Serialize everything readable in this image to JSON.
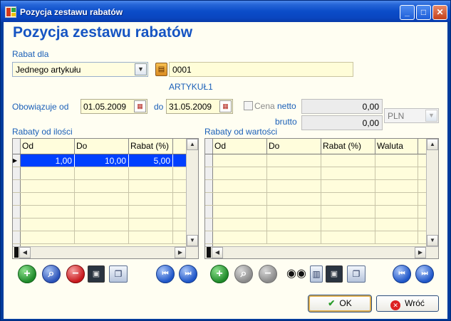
{
  "window": {
    "title": "Pozycja zestawu rabatów",
    "controls": {
      "minimize": "_",
      "maximize": "□",
      "close": "✕"
    }
  },
  "heading": "Pozycja zestawu rabatów",
  "rabat": {
    "label": "Rabat dla",
    "type_value": "Jednego artykułu",
    "code_value": "0001",
    "article_name": "ARTYKUŁ1"
  },
  "validity": {
    "label_from": "Obowiązuje od",
    "date_from": "01.05.2009",
    "label_to": "do",
    "date_to": "31.05.2009"
  },
  "price": {
    "checkbox_label": "Cena",
    "netto_label": "netto",
    "brutto_label": "brutto",
    "netto_value": "0,00",
    "brutto_value": "0,00",
    "currency": "PLN"
  },
  "grid_quantity": {
    "title": "Rabaty od ilości",
    "columns": [
      "Od",
      "Do",
      "Rabat (%)"
    ],
    "rows": [
      {
        "od": "1,00",
        "do": "10,00",
        "rabat": "5,00",
        "selected": true
      }
    ]
  },
  "grid_value": {
    "title": "Rabaty od wartości",
    "columns": [
      "Od",
      "Do",
      "Rabat (%)",
      "Waluta"
    ],
    "rows": []
  },
  "toolbar_icons": {
    "left": [
      "add-icon",
      "find-icon",
      "delete-icon",
      "save-icon",
      "copy-icon",
      "first-icon",
      "last-icon"
    ],
    "right": [
      "add-icon",
      "find-icon",
      "delete-icon",
      "binoculars-icon",
      "table-icon",
      "save-icon",
      "copy-icon",
      "first-icon",
      "last-icon"
    ]
  },
  "buttons": {
    "ok": "OK",
    "back": "Wróć"
  }
}
